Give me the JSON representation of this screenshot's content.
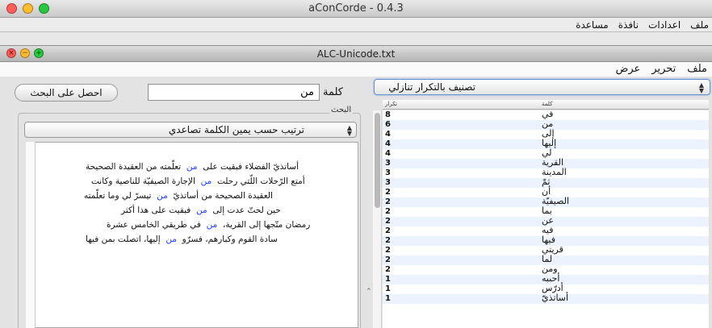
{
  "app": {
    "title": "aConCorde - 0.4.3"
  },
  "outer_menu": {
    "items": [
      "ملف",
      "اعدادات",
      "نافذة",
      "مساعدة"
    ]
  },
  "document": {
    "title": "ALC-Unicode.txt"
  },
  "inner_menu": {
    "items": [
      "ملف",
      "تحرير",
      "عرض"
    ]
  },
  "search": {
    "button_label": "احصل على البحث",
    "input_value": "من",
    "input_label": "كلمة"
  },
  "results_group": {
    "title": "البحث",
    "sort_value": "ترتيب حسب يمين الكلمة تصاعدي",
    "lines": [
      {
        "left": "تعلّمته من العقيدة الصحيحة",
        "kw": "من",
        "right": "أساتذيّ الفضلاء فبقيت على"
      },
      {
        "left": "الإجارة الصيفيّة للناصية وكانت",
        "kw": "من",
        "right": "أمتع الرّحلات اللّتي رحلت"
      },
      {
        "left": "تيسرّ لي وما تعلّمته",
        "kw": "من",
        "right": "العقيدة الصحيحة من أساتذيّ"
      },
      {
        "left": "فبقيت على هذا أكثر",
        "kw": "من",
        "right": "حين لحتّ عدت إلى"
      },
      {
        "left": "في طريقي الخامس عشرة",
        "kw": "من",
        "right": "رمضان متّجها إلى القرية،"
      },
      {
        "left": "إليها، اتصلت بمن فيها",
        "kw": "من",
        "right": "سادة القوم وكبارهم، فسرّو"
      }
    ]
  },
  "frequency": {
    "sort_value": "تصنيف بالتكرار تنازلي",
    "header": {
      "count": "تكرار",
      "word": "كلمة"
    },
    "rows": [
      {
        "count": "8",
        "word": "في"
      },
      {
        "count": "6",
        "word": "من"
      },
      {
        "count": "4",
        "word": "إلى"
      },
      {
        "count": "4",
        "word": "إليها"
      },
      {
        "count": "4",
        "word": "لي"
      },
      {
        "count": "3",
        "word": "القرية"
      },
      {
        "count": "3",
        "word": "المدينة"
      },
      {
        "count": "3",
        "word": "ثمّ"
      },
      {
        "count": "2",
        "word": "أن"
      },
      {
        "count": "2",
        "word": "الصيفيّة"
      },
      {
        "count": "2",
        "word": "بما"
      },
      {
        "count": "2",
        "word": "عن"
      },
      {
        "count": "2",
        "word": "فيه"
      },
      {
        "count": "2",
        "word": "فيها"
      },
      {
        "count": "2",
        "word": "قريتي"
      },
      {
        "count": "2",
        "word": "لما"
      },
      {
        "count": "2",
        "word": "ومن"
      },
      {
        "count": "1",
        "word": "أحببه"
      },
      {
        "count": "1",
        "word": "أدرّس"
      },
      {
        "count": "1",
        "word": "أساتذيّ"
      }
    ]
  },
  "colors": {
    "keyword": "#1a3cff",
    "row_alt": "#edf3fe",
    "close": "#ff5f57",
    "minimize": "#ffbd2e",
    "zoom": "#28c940"
  }
}
